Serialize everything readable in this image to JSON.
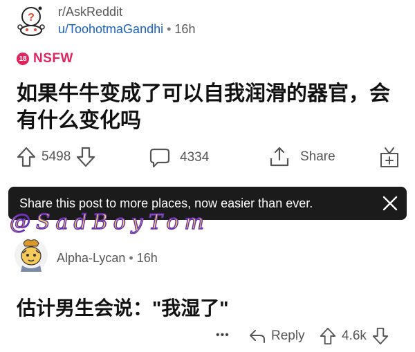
{
  "post": {
    "subreddit": "r/AskReddit",
    "author": "u/ToohotmaGandhi",
    "separator": "•",
    "age": "16h",
    "nsfw_badge": "18",
    "nsfw_label": "NSFW",
    "title": "如果牛牛变成了可以自我润滑的器官，会有什么变化吗",
    "upvotes": "5498",
    "comments": "4334",
    "share_label": "Share",
    "icons": [
      "snoo-avatar-icon",
      "upvote-arrow-icon",
      "downvote-arrow-icon",
      "comment-bubble-icon",
      "share-icon",
      "gift-icon"
    ]
  },
  "toast": {
    "message": "Share this post to more places, now easier than ever.",
    "close_icon": "close-icon"
  },
  "watermark": "@SadBoyTom",
  "comment": {
    "author": "Alpha-Lycan",
    "separator": "•",
    "age": "16h",
    "body": "估计男生会说：\"我湿了\"",
    "more_label": "•••",
    "reply_label": "Reply",
    "score": "4.6k",
    "icons": [
      "user-avatar-icon",
      "more-options-icon",
      "reply-arrow-icon",
      "upvote-arrow-icon",
      "downvote-arrow-icon"
    ]
  },
  "colors": {
    "nsfw": "#e0245e",
    "link": "#1a62c4",
    "toast_bg": "#1b1b1b",
    "watermark_fill": "#f4e04d",
    "watermark_stroke": "#6a2fb5"
  }
}
